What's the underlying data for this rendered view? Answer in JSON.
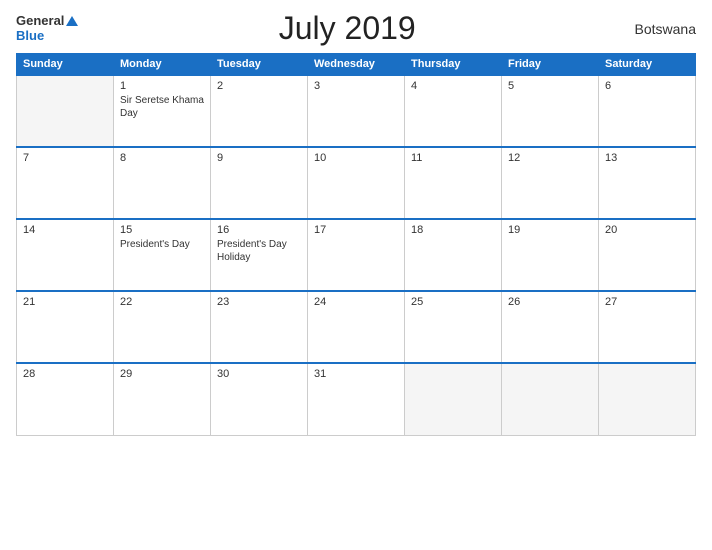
{
  "header": {
    "logo_general": "General",
    "logo_blue": "Blue",
    "title": "July 2019",
    "country": "Botswana"
  },
  "days_of_week": [
    "Sunday",
    "Monday",
    "Tuesday",
    "Wednesday",
    "Thursday",
    "Friday",
    "Saturday"
  ],
  "weeks": [
    [
      {
        "date": "",
        "event": "",
        "empty": true
      },
      {
        "date": "1",
        "event": "Sir Seretse Khama Day",
        "empty": false
      },
      {
        "date": "2",
        "event": "",
        "empty": false
      },
      {
        "date": "3",
        "event": "",
        "empty": false
      },
      {
        "date": "4",
        "event": "",
        "empty": false
      },
      {
        "date": "5",
        "event": "",
        "empty": false
      },
      {
        "date": "6",
        "event": "",
        "empty": false
      }
    ],
    [
      {
        "date": "7",
        "event": "",
        "empty": false
      },
      {
        "date": "8",
        "event": "",
        "empty": false
      },
      {
        "date": "9",
        "event": "",
        "empty": false
      },
      {
        "date": "10",
        "event": "",
        "empty": false
      },
      {
        "date": "11",
        "event": "",
        "empty": false
      },
      {
        "date": "12",
        "event": "",
        "empty": false
      },
      {
        "date": "13",
        "event": "",
        "empty": false
      }
    ],
    [
      {
        "date": "14",
        "event": "",
        "empty": false
      },
      {
        "date": "15",
        "event": "President's Day",
        "empty": false
      },
      {
        "date": "16",
        "event": "President's Day Holiday",
        "empty": false
      },
      {
        "date": "17",
        "event": "",
        "empty": false
      },
      {
        "date": "18",
        "event": "",
        "empty": false
      },
      {
        "date": "19",
        "event": "",
        "empty": false
      },
      {
        "date": "20",
        "event": "",
        "empty": false
      }
    ],
    [
      {
        "date": "21",
        "event": "",
        "empty": false
      },
      {
        "date": "22",
        "event": "",
        "empty": false
      },
      {
        "date": "23",
        "event": "",
        "empty": false
      },
      {
        "date": "24",
        "event": "",
        "empty": false
      },
      {
        "date": "25",
        "event": "",
        "empty": false
      },
      {
        "date": "26",
        "event": "",
        "empty": false
      },
      {
        "date": "27",
        "event": "",
        "empty": false
      }
    ],
    [
      {
        "date": "28",
        "event": "",
        "empty": false
      },
      {
        "date": "29",
        "event": "",
        "empty": false
      },
      {
        "date": "30",
        "event": "",
        "empty": false
      },
      {
        "date": "31",
        "event": "",
        "empty": false
      },
      {
        "date": "",
        "event": "",
        "empty": true
      },
      {
        "date": "",
        "event": "",
        "empty": true
      },
      {
        "date": "",
        "event": "",
        "empty": true
      }
    ]
  ]
}
